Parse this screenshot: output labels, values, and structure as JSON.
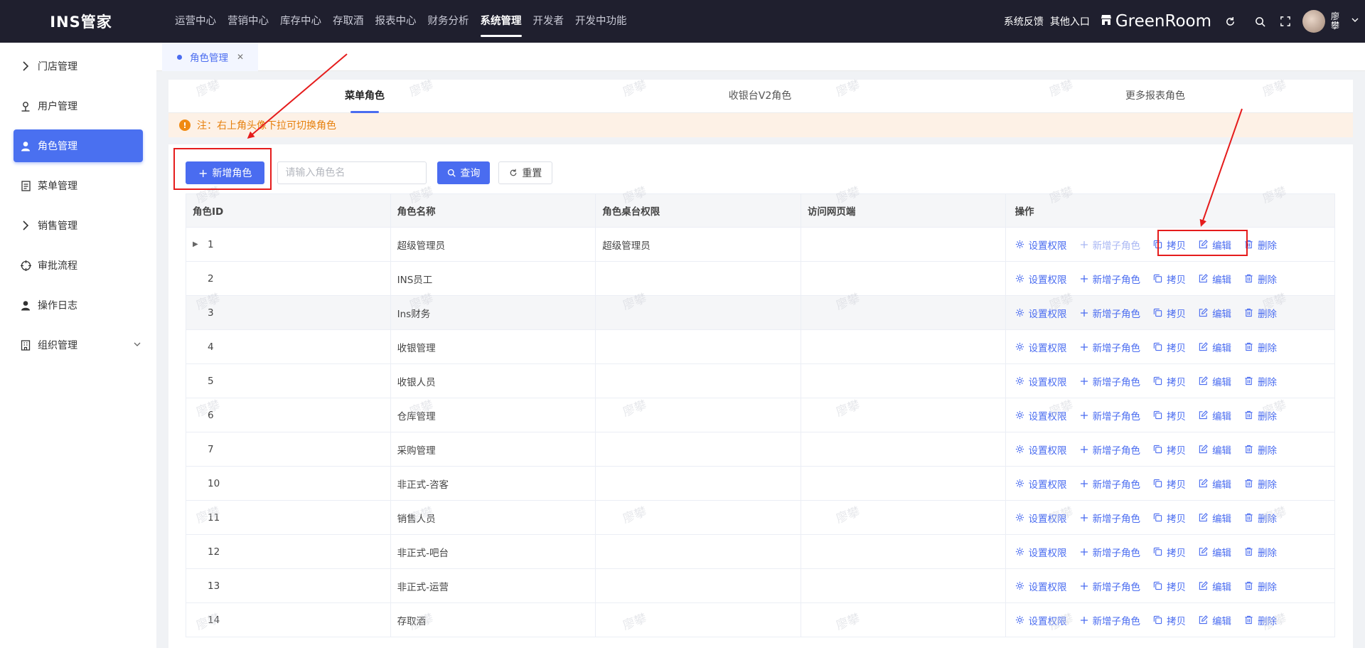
{
  "app": {
    "logo": "INS管家"
  },
  "topnav": [
    {
      "label": "运营中心",
      "active": false
    },
    {
      "label": "营销中心",
      "active": false
    },
    {
      "label": "库存中心",
      "active": false
    },
    {
      "label": "存取酒",
      "active": false
    },
    {
      "label": "报表中心",
      "active": false
    },
    {
      "label": "财务分析",
      "active": false
    },
    {
      "label": "系统管理",
      "active": true
    },
    {
      "label": "开发者",
      "active": false
    },
    {
      "label": "开发中功能",
      "active": false
    }
  ],
  "topright": {
    "feedback": "系统反馈",
    "other_entry": "其他入口",
    "store_name": "GreenRoom",
    "user_name": "廖攀"
  },
  "sidebar": [
    {
      "label": "门店管理",
      "icon": "chevron-right-icon",
      "active": false,
      "expandable": false
    },
    {
      "label": "用户管理",
      "icon": "user-outline-icon",
      "active": false,
      "expandable": false
    },
    {
      "label": "角色管理",
      "icon": "user-filled-icon",
      "active": true,
      "expandable": false
    },
    {
      "label": "菜单管理",
      "icon": "document-icon",
      "active": false,
      "expandable": false
    },
    {
      "label": "销售管理",
      "icon": "chevron-right-icon",
      "active": false,
      "expandable": false
    },
    {
      "label": "审批流程",
      "icon": "crosshair-icon",
      "active": false,
      "expandable": false
    },
    {
      "label": "操作日志",
      "icon": "user-filled-icon",
      "active": false,
      "expandable": false
    },
    {
      "label": "组织管理",
      "icon": "building-icon",
      "active": false,
      "expandable": true
    }
  ],
  "page_tab": {
    "label": "角色管理"
  },
  "subtabs": [
    {
      "label": "菜单角色",
      "active": true
    },
    {
      "label": "收银台V2角色",
      "active": false
    },
    {
      "label": "更多报表角色",
      "active": false
    }
  ],
  "notice": {
    "text": "注：右上角头像下拉可切换角色"
  },
  "toolbar": {
    "add_label": "新增角色",
    "search_placeholder": "请输入角色名",
    "query_label": "查询",
    "reset_label": "重置"
  },
  "table": {
    "columns": [
      "角色ID",
      "角色名称",
      "角色桌台权限",
      "访问网页端",
      "操作"
    ],
    "actions": {
      "set_perm": "设置权限",
      "add_child": "新增子角色",
      "copy": "拷贝",
      "edit": "编辑",
      "delete": "删除"
    },
    "rows": [
      {
        "id": "1",
        "name": "超级管理员",
        "table_perm": "超级管理员",
        "web": "",
        "expandable": true
      },
      {
        "id": "2",
        "name": "INS员工",
        "table_perm": "",
        "web": "",
        "expandable": false
      },
      {
        "id": "3",
        "name": "Ins财务",
        "table_perm": "",
        "web": "",
        "expandable": false
      },
      {
        "id": "4",
        "name": "收银管理",
        "table_perm": "",
        "web": "",
        "expandable": false
      },
      {
        "id": "5",
        "name": "收银人员",
        "table_perm": "",
        "web": "",
        "expandable": false
      },
      {
        "id": "6",
        "name": "仓库管理",
        "table_perm": "",
        "web": "",
        "expandable": false
      },
      {
        "id": "7",
        "name": "采购管理",
        "table_perm": "",
        "web": "",
        "expandable": false
      },
      {
        "id": "10",
        "name": "非正式-咨客",
        "table_perm": "",
        "web": "",
        "expandable": false
      },
      {
        "id": "11",
        "name": "销售人员",
        "table_perm": "",
        "web": "",
        "expandable": false
      },
      {
        "id": "12",
        "name": "非正式-吧台",
        "table_perm": "",
        "web": "",
        "expandable": false
      },
      {
        "id": "13",
        "name": "非正式-运营",
        "table_perm": "",
        "web": "",
        "expandable": false
      },
      {
        "id": "14",
        "name": "存取酒",
        "table_perm": "",
        "web": "",
        "expandable": false
      }
    ]
  },
  "watermark": "廖攀",
  "colors": {
    "primary": "#4a6cf0",
    "topbar": "#1f1f2e",
    "notice": "#e6800d",
    "annotation": "#e51c1c"
  }
}
